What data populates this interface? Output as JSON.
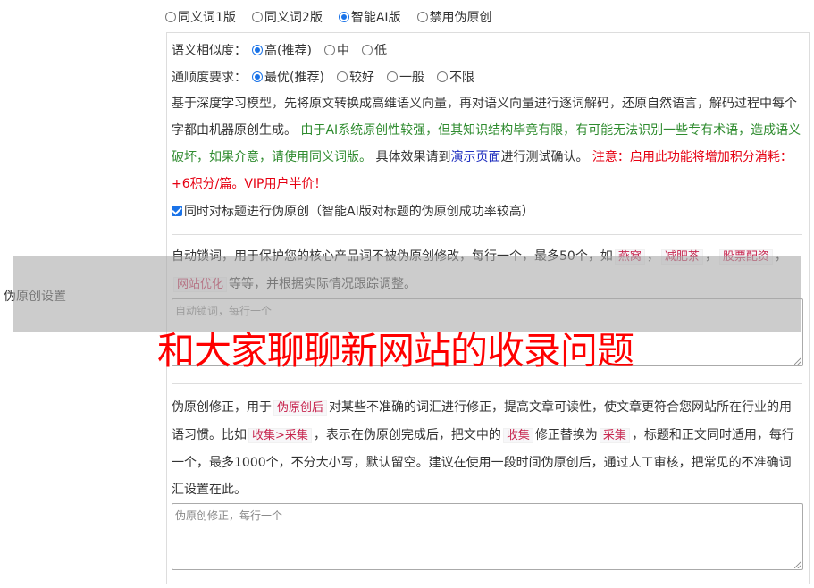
{
  "mode_options": [
    "同义词1版",
    "同义词2版",
    "智能AI版",
    "禁用伪原创"
  ],
  "similarity": {
    "label": "语义相似度：",
    "options": [
      "高(推荐)",
      "中",
      "低"
    ]
  },
  "fluency": {
    "label": "通顺度要求：",
    "options": [
      "最优(推荐)",
      "较好",
      "一般",
      "不限"
    ]
  },
  "desc": {
    "part1": "基于深度学习模型，先将原文转换成高维语义向量，再对语义向量进行逐词解码，还原自然语言，解码过程中每个字都由机器原创生成。",
    "green": "由于AI系统原创性较强，但其知识结构毕竟有限，有可能无法识别一些专有术语，造成语义破坏，如果介意，请使用同义词版。",
    "part2": "具体效果请到",
    "link": "演示页面",
    "part3": "进行测试确认。",
    "red": "注意：启用此功能将增加积分消耗：+6积分/篇。VIP用户半价！"
  },
  "title_checkbox_label": "同时对标题进行伪原创（智能AI版对标题的伪原创成功率较高）",
  "lock": {
    "text1": "自动锁词，用于保护您的核心产品词不被伪原创修改，每行一个，最多50个，如",
    "examples": [
      "燕窝",
      "减肥茶",
      "股票配资",
      "网站优化"
    ],
    "text2": "等等，并根据实际情况跟踪调整。",
    "placeholder": "自动锁词，每行一个"
  },
  "correct": {
    "t1": "伪原创修正，用于",
    "c1": "伪原创后",
    "t2": "对某些不准确的词汇进行修正，提高文章可读性，使文章更符合您网站所在行业的用语习惯。比如",
    "c2": "收集>采集",
    "t3": "，表示在伪原创完成后，把文中的",
    "c3": "收集",
    "t4": "修正替换为",
    "c4": "采集",
    "t5": "，标题和正文同时适用，每行一个，最多1000个，不分大小写，默认留空。建议在使用一段时间伪原创后，通过人工审核，把常见的不准确词汇设置在此。",
    "placeholder": "伪原创修正，每行一个"
  },
  "side_label": "伪原创设置",
  "banner": "和大家聊聊新网站的收录问题",
  "colors": {
    "accent": "#1a73e8",
    "green": "#2e8b2e",
    "red": "#e60012",
    "banner": "#ff0000"
  }
}
